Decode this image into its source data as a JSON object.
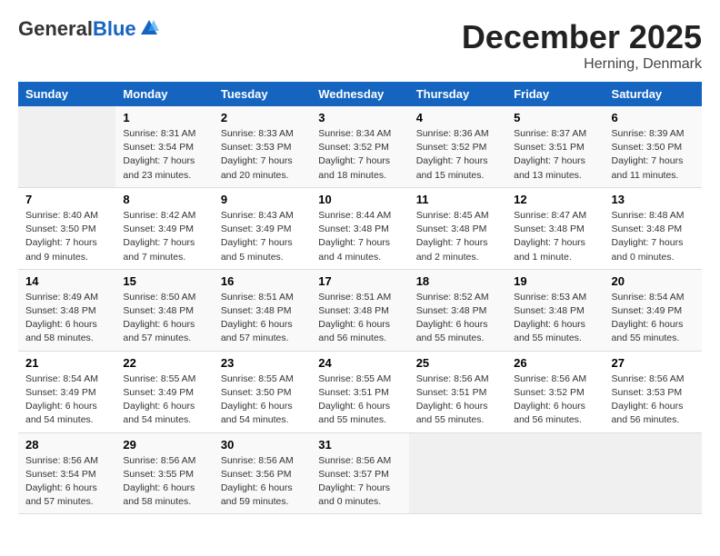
{
  "header": {
    "logo_general": "General",
    "logo_blue": "Blue",
    "title": "December 2025",
    "subtitle": "Herning, Denmark"
  },
  "columns": [
    "Sunday",
    "Monday",
    "Tuesday",
    "Wednesday",
    "Thursday",
    "Friday",
    "Saturday"
  ],
  "weeks": [
    [
      {
        "day": "",
        "info": ""
      },
      {
        "day": "1",
        "info": "Sunrise: 8:31 AM\nSunset: 3:54 PM\nDaylight: 7 hours\nand 23 minutes."
      },
      {
        "day": "2",
        "info": "Sunrise: 8:33 AM\nSunset: 3:53 PM\nDaylight: 7 hours\nand 20 minutes."
      },
      {
        "day": "3",
        "info": "Sunrise: 8:34 AM\nSunset: 3:52 PM\nDaylight: 7 hours\nand 18 minutes."
      },
      {
        "day": "4",
        "info": "Sunrise: 8:36 AM\nSunset: 3:52 PM\nDaylight: 7 hours\nand 15 minutes."
      },
      {
        "day": "5",
        "info": "Sunrise: 8:37 AM\nSunset: 3:51 PM\nDaylight: 7 hours\nand 13 minutes."
      },
      {
        "day": "6",
        "info": "Sunrise: 8:39 AM\nSunset: 3:50 PM\nDaylight: 7 hours\nand 11 minutes."
      }
    ],
    [
      {
        "day": "7",
        "info": "Sunrise: 8:40 AM\nSunset: 3:50 PM\nDaylight: 7 hours\nand 9 minutes."
      },
      {
        "day": "8",
        "info": "Sunrise: 8:42 AM\nSunset: 3:49 PM\nDaylight: 7 hours\nand 7 minutes."
      },
      {
        "day": "9",
        "info": "Sunrise: 8:43 AM\nSunset: 3:49 PM\nDaylight: 7 hours\nand 5 minutes."
      },
      {
        "day": "10",
        "info": "Sunrise: 8:44 AM\nSunset: 3:48 PM\nDaylight: 7 hours\nand 4 minutes."
      },
      {
        "day": "11",
        "info": "Sunrise: 8:45 AM\nSunset: 3:48 PM\nDaylight: 7 hours\nand 2 minutes."
      },
      {
        "day": "12",
        "info": "Sunrise: 8:47 AM\nSunset: 3:48 PM\nDaylight: 7 hours\nand 1 minute."
      },
      {
        "day": "13",
        "info": "Sunrise: 8:48 AM\nSunset: 3:48 PM\nDaylight: 7 hours\nand 0 minutes."
      }
    ],
    [
      {
        "day": "14",
        "info": "Sunrise: 8:49 AM\nSunset: 3:48 PM\nDaylight: 6 hours\nand 58 minutes."
      },
      {
        "day": "15",
        "info": "Sunrise: 8:50 AM\nSunset: 3:48 PM\nDaylight: 6 hours\nand 57 minutes."
      },
      {
        "day": "16",
        "info": "Sunrise: 8:51 AM\nSunset: 3:48 PM\nDaylight: 6 hours\nand 57 minutes."
      },
      {
        "day": "17",
        "info": "Sunrise: 8:51 AM\nSunset: 3:48 PM\nDaylight: 6 hours\nand 56 minutes."
      },
      {
        "day": "18",
        "info": "Sunrise: 8:52 AM\nSunset: 3:48 PM\nDaylight: 6 hours\nand 55 minutes."
      },
      {
        "day": "19",
        "info": "Sunrise: 8:53 AM\nSunset: 3:48 PM\nDaylight: 6 hours\nand 55 minutes."
      },
      {
        "day": "20",
        "info": "Sunrise: 8:54 AM\nSunset: 3:49 PM\nDaylight: 6 hours\nand 55 minutes."
      }
    ],
    [
      {
        "day": "21",
        "info": "Sunrise: 8:54 AM\nSunset: 3:49 PM\nDaylight: 6 hours\nand 54 minutes."
      },
      {
        "day": "22",
        "info": "Sunrise: 8:55 AM\nSunset: 3:49 PM\nDaylight: 6 hours\nand 54 minutes."
      },
      {
        "day": "23",
        "info": "Sunrise: 8:55 AM\nSunset: 3:50 PM\nDaylight: 6 hours\nand 54 minutes."
      },
      {
        "day": "24",
        "info": "Sunrise: 8:55 AM\nSunset: 3:51 PM\nDaylight: 6 hours\nand 55 minutes."
      },
      {
        "day": "25",
        "info": "Sunrise: 8:56 AM\nSunset: 3:51 PM\nDaylight: 6 hours\nand 55 minutes."
      },
      {
        "day": "26",
        "info": "Sunrise: 8:56 AM\nSunset: 3:52 PM\nDaylight: 6 hours\nand 56 minutes."
      },
      {
        "day": "27",
        "info": "Sunrise: 8:56 AM\nSunset: 3:53 PM\nDaylight: 6 hours\nand 56 minutes."
      }
    ],
    [
      {
        "day": "28",
        "info": "Sunrise: 8:56 AM\nSunset: 3:54 PM\nDaylight: 6 hours\nand 57 minutes."
      },
      {
        "day": "29",
        "info": "Sunrise: 8:56 AM\nSunset: 3:55 PM\nDaylight: 6 hours\nand 58 minutes."
      },
      {
        "day": "30",
        "info": "Sunrise: 8:56 AM\nSunset: 3:56 PM\nDaylight: 6 hours\nand 59 minutes."
      },
      {
        "day": "31",
        "info": "Sunrise: 8:56 AM\nSunset: 3:57 PM\nDaylight: 7 hours\nand 0 minutes."
      },
      {
        "day": "",
        "info": ""
      },
      {
        "day": "",
        "info": ""
      },
      {
        "day": "",
        "info": ""
      }
    ]
  ]
}
